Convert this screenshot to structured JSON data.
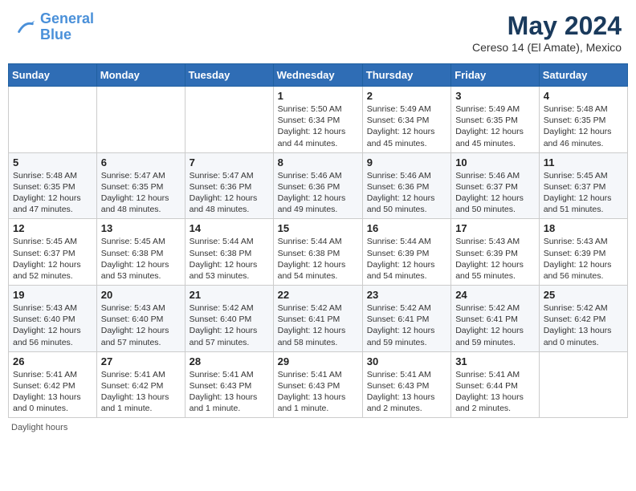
{
  "header": {
    "logo_line1": "General",
    "logo_line2": "Blue",
    "month_title": "May 2024",
    "subtitle": "Cereso 14 (El Amate), Mexico"
  },
  "days_of_week": [
    "Sunday",
    "Monday",
    "Tuesday",
    "Wednesday",
    "Thursday",
    "Friday",
    "Saturday"
  ],
  "footer_label": "Daylight hours",
  "weeks": [
    [
      {
        "day": "",
        "info": ""
      },
      {
        "day": "",
        "info": ""
      },
      {
        "day": "",
        "info": ""
      },
      {
        "day": "1",
        "info": "Sunrise: 5:50 AM\nSunset: 6:34 PM\nDaylight: 12 hours\nand 44 minutes."
      },
      {
        "day": "2",
        "info": "Sunrise: 5:49 AM\nSunset: 6:34 PM\nDaylight: 12 hours\nand 45 minutes."
      },
      {
        "day": "3",
        "info": "Sunrise: 5:49 AM\nSunset: 6:35 PM\nDaylight: 12 hours\nand 45 minutes."
      },
      {
        "day": "4",
        "info": "Sunrise: 5:48 AM\nSunset: 6:35 PM\nDaylight: 12 hours\nand 46 minutes."
      }
    ],
    [
      {
        "day": "5",
        "info": "Sunrise: 5:48 AM\nSunset: 6:35 PM\nDaylight: 12 hours\nand 47 minutes."
      },
      {
        "day": "6",
        "info": "Sunrise: 5:47 AM\nSunset: 6:35 PM\nDaylight: 12 hours\nand 48 minutes."
      },
      {
        "day": "7",
        "info": "Sunrise: 5:47 AM\nSunset: 6:36 PM\nDaylight: 12 hours\nand 48 minutes."
      },
      {
        "day": "8",
        "info": "Sunrise: 5:46 AM\nSunset: 6:36 PM\nDaylight: 12 hours\nand 49 minutes."
      },
      {
        "day": "9",
        "info": "Sunrise: 5:46 AM\nSunset: 6:36 PM\nDaylight: 12 hours\nand 50 minutes."
      },
      {
        "day": "10",
        "info": "Sunrise: 5:46 AM\nSunset: 6:37 PM\nDaylight: 12 hours\nand 50 minutes."
      },
      {
        "day": "11",
        "info": "Sunrise: 5:45 AM\nSunset: 6:37 PM\nDaylight: 12 hours\nand 51 minutes."
      }
    ],
    [
      {
        "day": "12",
        "info": "Sunrise: 5:45 AM\nSunset: 6:37 PM\nDaylight: 12 hours\nand 52 minutes."
      },
      {
        "day": "13",
        "info": "Sunrise: 5:45 AM\nSunset: 6:38 PM\nDaylight: 12 hours\nand 53 minutes."
      },
      {
        "day": "14",
        "info": "Sunrise: 5:44 AM\nSunset: 6:38 PM\nDaylight: 12 hours\nand 53 minutes."
      },
      {
        "day": "15",
        "info": "Sunrise: 5:44 AM\nSunset: 6:38 PM\nDaylight: 12 hours\nand 54 minutes."
      },
      {
        "day": "16",
        "info": "Sunrise: 5:44 AM\nSunset: 6:39 PM\nDaylight: 12 hours\nand 54 minutes."
      },
      {
        "day": "17",
        "info": "Sunrise: 5:43 AM\nSunset: 6:39 PM\nDaylight: 12 hours\nand 55 minutes."
      },
      {
        "day": "18",
        "info": "Sunrise: 5:43 AM\nSunset: 6:39 PM\nDaylight: 12 hours\nand 56 minutes."
      }
    ],
    [
      {
        "day": "19",
        "info": "Sunrise: 5:43 AM\nSunset: 6:40 PM\nDaylight: 12 hours\nand 56 minutes."
      },
      {
        "day": "20",
        "info": "Sunrise: 5:43 AM\nSunset: 6:40 PM\nDaylight: 12 hours\nand 57 minutes."
      },
      {
        "day": "21",
        "info": "Sunrise: 5:42 AM\nSunset: 6:40 PM\nDaylight: 12 hours\nand 57 minutes."
      },
      {
        "day": "22",
        "info": "Sunrise: 5:42 AM\nSunset: 6:41 PM\nDaylight: 12 hours\nand 58 minutes."
      },
      {
        "day": "23",
        "info": "Sunrise: 5:42 AM\nSunset: 6:41 PM\nDaylight: 12 hours\nand 59 minutes."
      },
      {
        "day": "24",
        "info": "Sunrise: 5:42 AM\nSunset: 6:41 PM\nDaylight: 12 hours\nand 59 minutes."
      },
      {
        "day": "25",
        "info": "Sunrise: 5:42 AM\nSunset: 6:42 PM\nDaylight: 13 hours\nand 0 minutes."
      }
    ],
    [
      {
        "day": "26",
        "info": "Sunrise: 5:41 AM\nSunset: 6:42 PM\nDaylight: 13 hours\nand 0 minutes."
      },
      {
        "day": "27",
        "info": "Sunrise: 5:41 AM\nSunset: 6:42 PM\nDaylight: 13 hours\nand 1 minute."
      },
      {
        "day": "28",
        "info": "Sunrise: 5:41 AM\nSunset: 6:43 PM\nDaylight: 13 hours\nand 1 minute."
      },
      {
        "day": "29",
        "info": "Sunrise: 5:41 AM\nSunset: 6:43 PM\nDaylight: 13 hours\nand 1 minute."
      },
      {
        "day": "30",
        "info": "Sunrise: 5:41 AM\nSunset: 6:43 PM\nDaylight: 13 hours\nand 2 minutes."
      },
      {
        "day": "31",
        "info": "Sunrise: 5:41 AM\nSunset: 6:44 PM\nDaylight: 13 hours\nand 2 minutes."
      },
      {
        "day": "",
        "info": ""
      }
    ]
  ]
}
